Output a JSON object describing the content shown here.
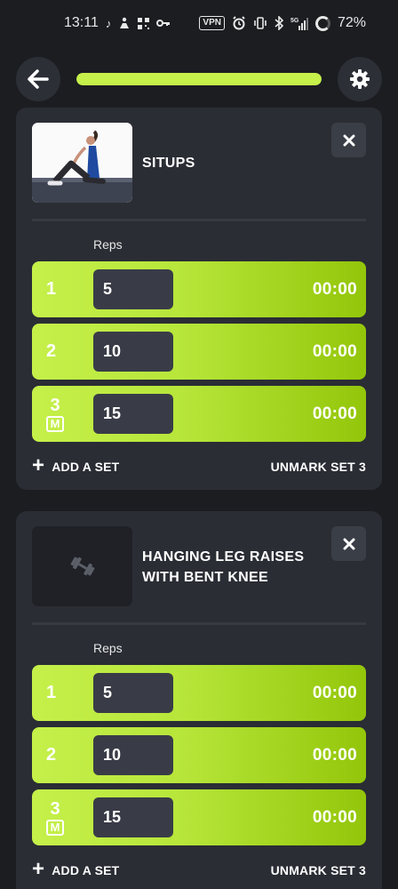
{
  "status_bar": {
    "time": "13:11",
    "battery": "72%",
    "vpn": "VPN",
    "network": "5G",
    "left_icons": [
      "tiktok-icon",
      "person-icon",
      "qr-icon",
      "key-icon"
    ],
    "right_icons": [
      "vpn-icon",
      "alarm-icon",
      "vibrate-icon",
      "bluetooth-icon",
      "signal-icon",
      "battery-icon"
    ]
  },
  "header": {
    "progress": 1.0,
    "accent_color": "#c6f04a"
  },
  "exercises": [
    {
      "title": "SITUPS",
      "reps_label": "Reps",
      "sets": [
        {
          "num": "1",
          "reps": "5",
          "time": "00:00",
          "marked": false
        },
        {
          "num": "2",
          "reps": "10",
          "time": "00:00",
          "marked": false
        },
        {
          "num": "3",
          "reps": "15",
          "time": "00:00",
          "marked": true,
          "mark": "M"
        }
      ],
      "add_set_label": "ADD A SET",
      "unmark_label": "UNMARK SET 3"
    },
    {
      "title": "HANGING LEG RAISES WITH BENT KNEE",
      "reps_label": "Reps",
      "sets": [
        {
          "num": "1",
          "reps": "5",
          "time": "00:00",
          "marked": false
        },
        {
          "num": "2",
          "reps": "10",
          "time": "00:00",
          "marked": false
        },
        {
          "num": "3",
          "reps": "15",
          "time": "00:00",
          "marked": true,
          "mark": "M"
        }
      ],
      "add_set_label": "ADD A SET",
      "unmark_label": "UNMARK SET 3"
    }
  ]
}
